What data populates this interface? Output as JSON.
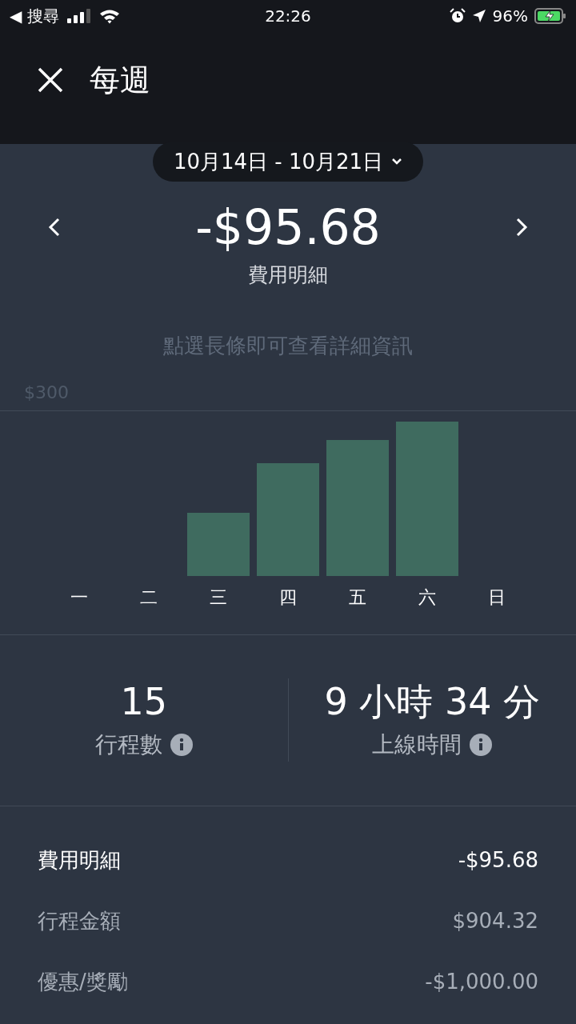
{
  "status_bar": {
    "back_label": "◀ 搜尋",
    "time": "22:26",
    "battery": "96%"
  },
  "header": {
    "title": "每週"
  },
  "date_range": "10月14日 - 10月21日",
  "summary": {
    "amount": "-$95.68",
    "label": "費用明細"
  },
  "chart": {
    "hint": "點選長條即可查看詳細資訊",
    "axis_label": "$300",
    "days": [
      "一",
      "二",
      "三",
      "四",
      "五",
      "六",
      "日"
    ]
  },
  "stats": [
    {
      "value": "15",
      "label": "行程數"
    },
    {
      "value": "9 小時 34 分",
      "label": "上線時間"
    }
  ],
  "rows": [
    {
      "kind": "total",
      "label": "費用明細",
      "amount": "-$95.68"
    },
    {
      "kind": "item",
      "label": "行程金額",
      "amount": "$904.32"
    },
    {
      "kind": "item",
      "label": "優惠/獎勵",
      "amount": "-$1,000.00"
    }
  ]
}
